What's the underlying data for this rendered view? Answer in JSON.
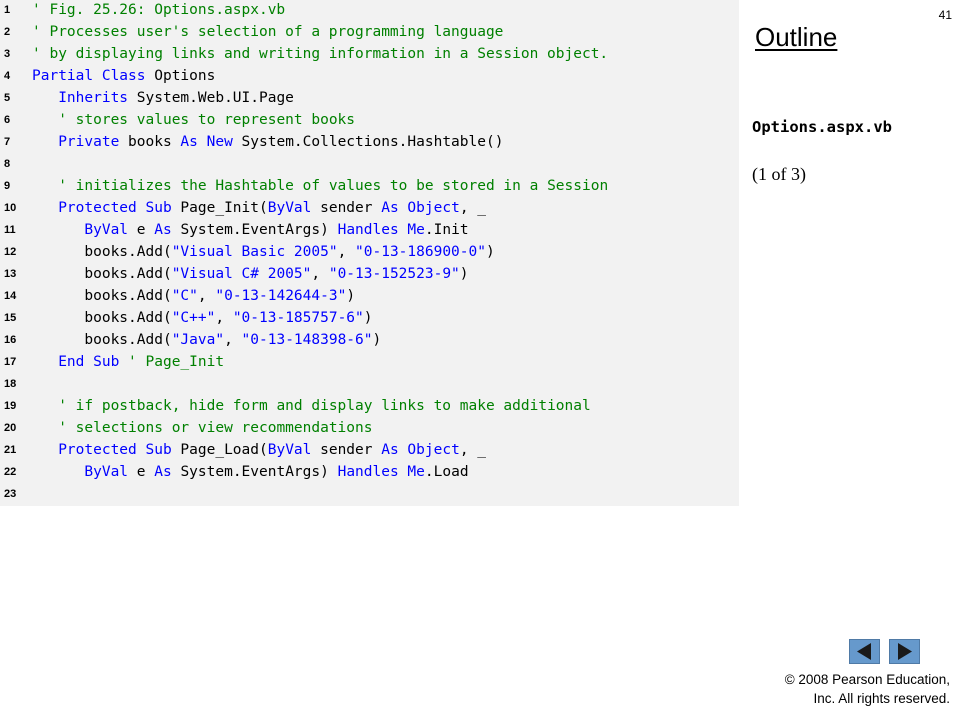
{
  "slide_number": "41",
  "outline": {
    "title": "Outline",
    "file_label": "Options.aspx.vb",
    "part_label": "(1 of 3)"
  },
  "nav": {
    "prev_icon": "triangle-left-icon",
    "next_icon": "triangle-right-icon",
    "button_color": "#6699cc"
  },
  "copyright": {
    "line1": "© 2008 Pearson Education,",
    "line2": "Inc.  All rights reserved."
  },
  "colors": {
    "comment": "#008000",
    "keyword": "#0000ff",
    "string": "#0000ff",
    "panel_background": "#f2f2f2"
  },
  "code": [
    {
      "n": "1",
      "tokens": [
        {
          "t": "' Fig. 25.26: Options.aspx.vb",
          "c": "comment"
        }
      ]
    },
    {
      "n": "2",
      "tokens": [
        {
          "t": "' Processes user's selection of a programming language",
          "c": "comment"
        }
      ]
    },
    {
      "n": "3",
      "tokens": [
        {
          "t": "' by displaying links and writing information in a Session object.",
          "c": "comment"
        }
      ]
    },
    {
      "n": "4",
      "tokens": [
        {
          "t": "Partial Class",
          "c": "kw"
        },
        {
          "t": " Options",
          "c": "plain"
        }
      ]
    },
    {
      "n": "5",
      "tokens": [
        {
          "t": "   ",
          "c": "plain"
        },
        {
          "t": "Inherits",
          "c": "kw"
        },
        {
          "t": " System.Web.UI.Page",
          "c": "plain"
        }
      ]
    },
    {
      "n": "6",
      "tokens": [
        {
          "t": "   ",
          "c": "plain"
        },
        {
          "t": "' stores values to represent books",
          "c": "comment"
        }
      ]
    },
    {
      "n": "7",
      "tokens": [
        {
          "t": "   ",
          "c": "plain"
        },
        {
          "t": "Private",
          "c": "kw"
        },
        {
          "t": " books ",
          "c": "plain"
        },
        {
          "t": "As New",
          "c": "kw"
        },
        {
          "t": " System.Collections.Hashtable()",
          "c": "plain"
        }
      ]
    },
    {
      "n": "8",
      "tokens": []
    },
    {
      "n": "9",
      "tokens": [
        {
          "t": "   ",
          "c": "plain"
        },
        {
          "t": "' initializes the Hashtable of values to be stored in a Session",
          "c": "comment"
        }
      ]
    },
    {
      "n": "10",
      "tokens": [
        {
          "t": "   ",
          "c": "plain"
        },
        {
          "t": "Protected Sub",
          "c": "kw"
        },
        {
          "t": " Page_Init(",
          "c": "plain"
        },
        {
          "t": "ByVal",
          "c": "kw"
        },
        {
          "t": " sender ",
          "c": "plain"
        },
        {
          "t": "As Object",
          "c": "kw"
        },
        {
          "t": ", _",
          "c": "plain"
        }
      ]
    },
    {
      "n": "11",
      "tokens": [
        {
          "t": "      ",
          "c": "plain"
        },
        {
          "t": "ByVal",
          "c": "kw"
        },
        {
          "t": " e ",
          "c": "plain"
        },
        {
          "t": "As",
          "c": "kw"
        },
        {
          "t": " System.EventArgs) ",
          "c": "plain"
        },
        {
          "t": "Handles Me",
          "c": "kw"
        },
        {
          "t": ".Init",
          "c": "plain"
        }
      ]
    },
    {
      "n": "12",
      "tokens": [
        {
          "t": "      books.Add(",
          "c": "plain"
        },
        {
          "t": "\"Visual Basic 2005\"",
          "c": "str"
        },
        {
          "t": ", ",
          "c": "plain"
        },
        {
          "t": "\"0-13-186900-0\"",
          "c": "str"
        },
        {
          "t": ")",
          "c": "plain"
        }
      ]
    },
    {
      "n": "13",
      "tokens": [
        {
          "t": "      books.Add(",
          "c": "plain"
        },
        {
          "t": "\"Visual C# 2005\"",
          "c": "str"
        },
        {
          "t": ", ",
          "c": "plain"
        },
        {
          "t": "\"0-13-152523-9\"",
          "c": "str"
        },
        {
          "t": ")",
          "c": "plain"
        }
      ]
    },
    {
      "n": "14",
      "tokens": [
        {
          "t": "      books.Add(",
          "c": "plain"
        },
        {
          "t": "\"C\"",
          "c": "str"
        },
        {
          "t": ", ",
          "c": "plain"
        },
        {
          "t": "\"0-13-142644-3\"",
          "c": "str"
        },
        {
          "t": ")",
          "c": "plain"
        }
      ]
    },
    {
      "n": "15",
      "tokens": [
        {
          "t": "      books.Add(",
          "c": "plain"
        },
        {
          "t": "\"C++\"",
          "c": "str"
        },
        {
          "t": ", ",
          "c": "plain"
        },
        {
          "t": "\"0-13-185757-6\"",
          "c": "str"
        },
        {
          "t": ")",
          "c": "plain"
        }
      ]
    },
    {
      "n": "16",
      "tokens": [
        {
          "t": "      books.Add(",
          "c": "plain"
        },
        {
          "t": "\"Java\"",
          "c": "str"
        },
        {
          "t": ", ",
          "c": "plain"
        },
        {
          "t": "\"0-13-148398-6\"",
          "c": "str"
        },
        {
          "t": ")",
          "c": "plain"
        }
      ]
    },
    {
      "n": "17",
      "tokens": [
        {
          "t": "   ",
          "c": "plain"
        },
        {
          "t": "End Sub",
          "c": "kw"
        },
        {
          "t": " ",
          "c": "plain"
        },
        {
          "t": "' Page_Init",
          "c": "comment"
        }
      ]
    },
    {
      "n": "18",
      "tokens": []
    },
    {
      "n": "19",
      "tokens": [
        {
          "t": "   ",
          "c": "plain"
        },
        {
          "t": "' if postback, hide form and display links to make additional",
          "c": "comment"
        }
      ]
    },
    {
      "n": "20",
      "tokens": [
        {
          "t": "   ",
          "c": "plain"
        },
        {
          "t": "' selections or view recommendations",
          "c": "comment"
        }
      ]
    },
    {
      "n": "21",
      "tokens": [
        {
          "t": "   ",
          "c": "plain"
        },
        {
          "t": "Protected Sub",
          "c": "kw"
        },
        {
          "t": " Page_Load(",
          "c": "plain"
        },
        {
          "t": "ByVal",
          "c": "kw"
        },
        {
          "t": " sender ",
          "c": "plain"
        },
        {
          "t": "As Object",
          "c": "kw"
        },
        {
          "t": ", _",
          "c": "plain"
        }
      ]
    },
    {
      "n": "22",
      "tokens": [
        {
          "t": "      ",
          "c": "plain"
        },
        {
          "t": "ByVal",
          "c": "kw"
        },
        {
          "t": " e ",
          "c": "plain"
        },
        {
          "t": "As",
          "c": "kw"
        },
        {
          "t": " System.EventArgs) ",
          "c": "plain"
        },
        {
          "t": "Handles Me",
          "c": "kw"
        },
        {
          "t": ".Load",
          "c": "plain"
        }
      ]
    },
    {
      "n": "23",
      "tokens": []
    }
  ]
}
